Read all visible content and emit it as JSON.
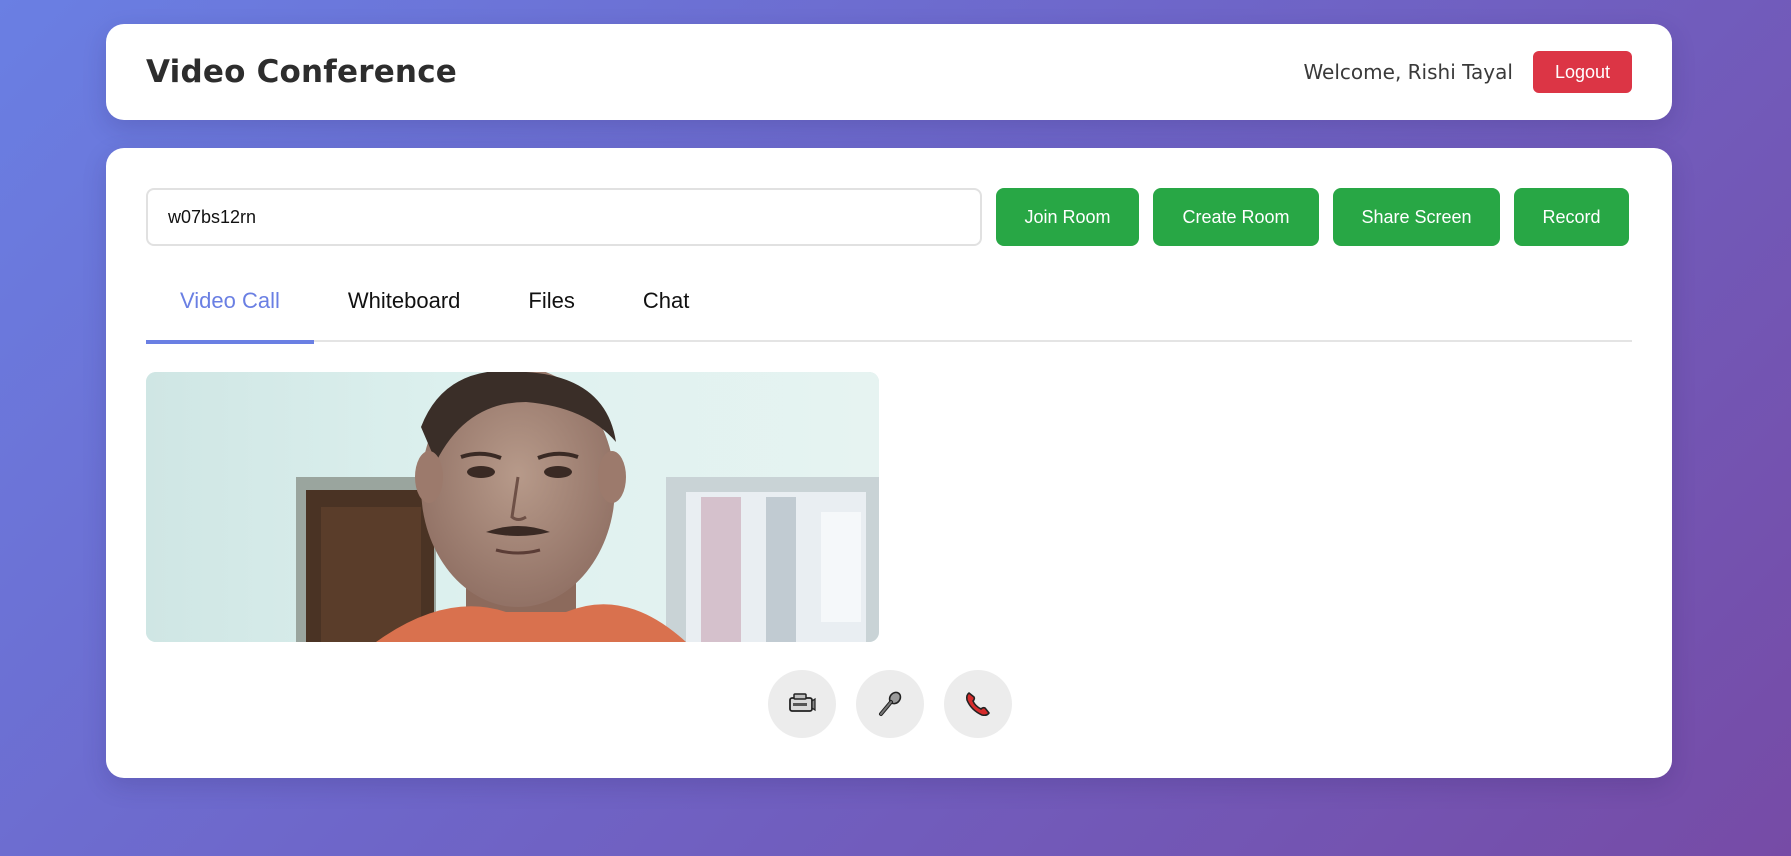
{
  "header": {
    "title": "Video Conference",
    "welcome": "Welcome, Rishi Tayal",
    "logout_label": "Logout"
  },
  "room": {
    "room_id_value": "w07bs12rn",
    "join_label": "Join Room",
    "create_label": "Create Room",
    "share_label": "Share Screen",
    "record_label": "Record"
  },
  "tabs": [
    {
      "label": "Video Call",
      "active": true
    },
    {
      "label": "Whiteboard",
      "active": false
    },
    {
      "label": "Files",
      "active": false
    },
    {
      "label": "Chat",
      "active": false
    }
  ],
  "video": {
    "description_icon": "local-video-feed"
  },
  "controls": [
    {
      "icon": "video-camera-icon"
    },
    {
      "icon": "microphone-icon"
    },
    {
      "icon": "end-call-icon"
    }
  ],
  "colors": {
    "accent": "#6a7fe3",
    "green": "#28a745",
    "danger": "#dc3545"
  }
}
